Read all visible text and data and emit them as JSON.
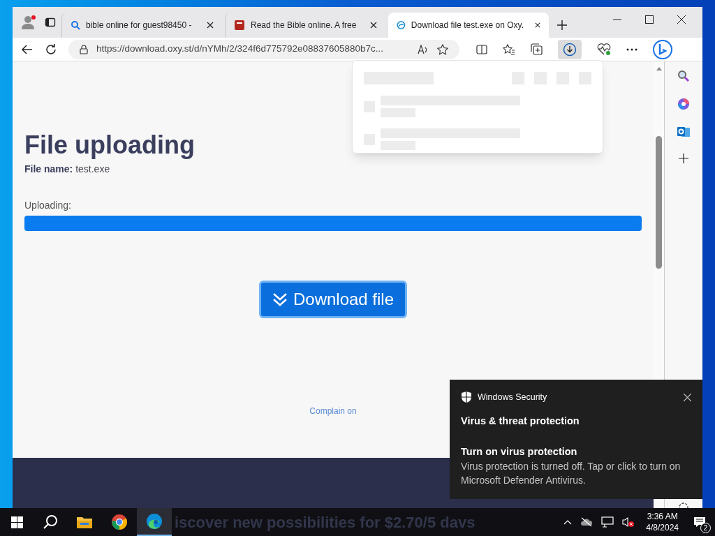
{
  "browser": {
    "tabs": [
      {
        "kind": "search",
        "title": "bible online for guest98450 -",
        "selected": false
      },
      {
        "kind": "book",
        "title": "Read the Bible online. A free",
        "selected": false
      },
      {
        "kind": "site",
        "title": "Download file test.exe on Oxy.",
        "selected": true
      }
    ],
    "address": "https://download.oxy.st/d/nYMh/2/324f6d775792e08837605880b7c...",
    "downloads_open": true
  },
  "page": {
    "heading": "File uploading",
    "file_label": "File name:",
    "file_name": "test.exe",
    "progress_label": "Uploading:",
    "progress": {
      "level": 1
    },
    "button": "Download file",
    "complain_link": "Complain on"
  },
  "toast": {
    "app": "Windows Security",
    "title": "Virus & threat protection",
    "subtitle": "Turn on virus protection",
    "body": "Virus protection is turned off. Tap or click to turn on Microsoft Defender Antivirus."
  },
  "taskbar": {
    "apps": [
      {
        "kind": "explorer",
        "active": false
      },
      {
        "kind": "chrome",
        "active": false
      },
      {
        "kind": "edge",
        "active": true
      }
    ],
    "banner": "iscover new possibilities for **$2.70/5 davs**",
    "time": "3:36 AM",
    "date": "4/8/2024",
    "notifications": "2"
  }
}
